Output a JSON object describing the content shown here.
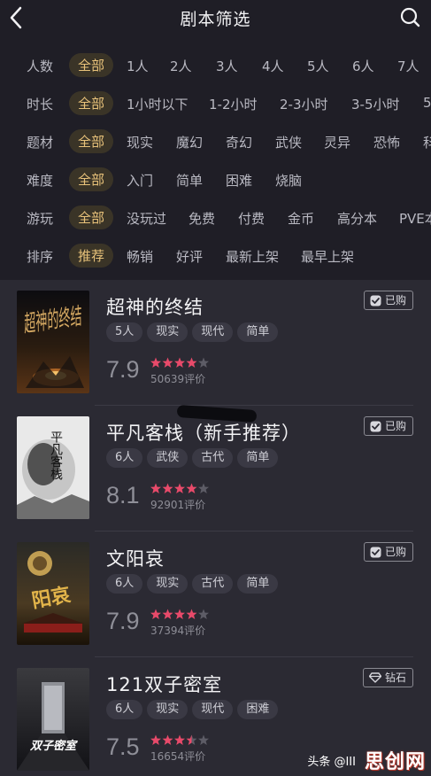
{
  "header": {
    "title": "剧本筛选"
  },
  "filters": [
    {
      "label": "人数",
      "options": [
        "全部",
        "1人",
        "2人",
        "3人",
        "4人",
        "5人",
        "6人",
        "7人"
      ],
      "selected": 0
    },
    {
      "label": "时长",
      "options": [
        "全部",
        "1小时以下",
        "1-2小时",
        "2-3小时",
        "3-5小时",
        "5"
      ],
      "selected": 0
    },
    {
      "label": "题材",
      "options": [
        "全部",
        "现实",
        "魔幻",
        "奇幻",
        "武侠",
        "灵异",
        "恐怖",
        "科"
      ],
      "selected": 0
    },
    {
      "label": "难度",
      "options": [
        "全部",
        "入门",
        "简单",
        "困难",
        "烧脑"
      ],
      "selected": 0
    },
    {
      "label": "游玩",
      "options": [
        "全部",
        "没玩过",
        "免费",
        "付费",
        "金币",
        "高分本",
        "PVE本"
      ],
      "selected": 0
    },
    {
      "label": "排序",
      "options": [
        "推荐",
        "畅销",
        "好评",
        "最新上架",
        "最早上架"
      ],
      "selected": 0
    }
  ],
  "items": [
    {
      "name": "超神的终结",
      "tags": [
        "5人",
        "现实",
        "现代",
        "简单"
      ],
      "score": "7.9",
      "stars": 4,
      "reviews": "50639评价",
      "badge": "已购",
      "badge_icon": "check-icon",
      "cover_text": "超神的终结"
    },
    {
      "name": "平凡客栈（新手推荐）",
      "tags": [
        "6人",
        "武侠",
        "古代",
        "简单"
      ],
      "score": "8.1",
      "stars": 4,
      "reviews": "92901评价",
      "badge": "已购",
      "badge_icon": "check-icon",
      "cover_text": "平凡客栈"
    },
    {
      "name": "文阳哀",
      "tags": [
        "6人",
        "现实",
        "古代",
        "简单"
      ],
      "score": "7.9",
      "stars": 4,
      "reviews": "37394评价",
      "badge": "已购",
      "badge_icon": "check-icon",
      "cover_text": "阳哀"
    },
    {
      "name": "121双子密室",
      "tags": [
        "6人",
        "现实",
        "现代",
        "困难"
      ],
      "score": "7.5",
      "stars": 3.5,
      "reviews": "16654评价",
      "badge": "钻石",
      "badge_icon": "diamond-icon",
      "cover_text": "双子密室"
    }
  ],
  "watermark": {
    "text": "头条 @III",
    "logo": "思创网"
  },
  "colors": {
    "background": "#2b2a33",
    "panel": "#1f1e26",
    "selected_chip": "#3a3427",
    "selected_text": "#e8c27a",
    "star": "#e84a6a"
  }
}
